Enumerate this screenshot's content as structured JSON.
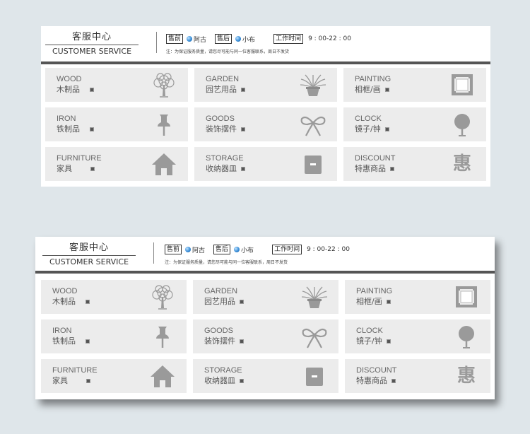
{
  "header": {
    "title_cn": "客服中心",
    "title_en": "CUSTOMER SERVICE",
    "presale_tag": "售前",
    "presale_agent": "阿古",
    "aftersale_tag": "售后",
    "aftersale_agent": "小布",
    "hours_tag": "工作时间",
    "hours_value": "9 : 00-22 : 00",
    "note": "注：为保证服务质量，请您尽可能与同一位客服联系，周日不发货"
  },
  "categories": [
    {
      "en": "WOOD",
      "cn": "木制品",
      "icon": "tree-icon"
    },
    {
      "en": "GARDEN",
      "cn": "园艺用品",
      "icon": "potted-plant-icon"
    },
    {
      "en": "PAINTING",
      "cn": "相框/画",
      "icon": "picture-frame-icon"
    },
    {
      "en": "IRON",
      "cn": "铁制品",
      "icon": "pushpin-icon"
    },
    {
      "en": "GOODS",
      "cn": "装饰摆件",
      "icon": "bow-icon"
    },
    {
      "en": "CLOCK",
      "cn": "镜子/钟",
      "icon": "clock-icon"
    },
    {
      "en": "FURNITURE",
      "cn": "家具",
      "icon": "house-icon"
    },
    {
      "en": "STORAGE",
      "cn": "收纳器皿",
      "icon": "storage-box-icon"
    },
    {
      "en": "DISCOUNT",
      "cn": "特惠商品",
      "icon": "discount-icon",
      "icon_text": "惠"
    }
  ],
  "colors": {
    "background": "#dfe6ea",
    "panel": "#ffffff",
    "cell": "#ececec",
    "bar": "#555555",
    "icon": "#9a9a9a",
    "agent_dot": "#3b8fd8"
  }
}
